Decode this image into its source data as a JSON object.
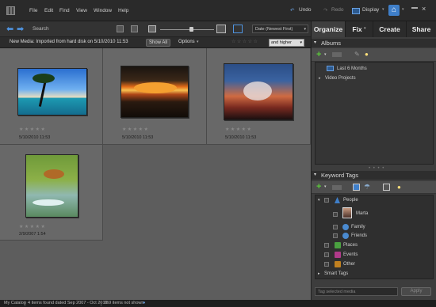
{
  "menu": [
    "File",
    "Edit",
    "Find",
    "View",
    "Window",
    "Help"
  ],
  "toolbar_right": {
    "undo": "Undo",
    "redo": "Redo",
    "display": "Display"
  },
  "tabs": [
    "Organize",
    "Fix",
    "Create",
    "Share"
  ],
  "search": {
    "label": "Search"
  },
  "sort": {
    "selected": "Date (Newest First)"
  },
  "mediabar": {
    "text": "New Media: Imported from hard disk on 5/10/2010 11:53",
    "show_all": "Show All",
    "options": "Options",
    "rating_filter": "and higher"
  },
  "photos": [
    {
      "date": "5/10/2010 11:53",
      "stars": "★★★★★",
      "subject": "tropical beach with palm tree"
    },
    {
      "date": "5/10/2010 11:53",
      "stars": "★★★★★",
      "subject": "sunset cloud over water"
    },
    {
      "date": "5/10/2010 11:53",
      "stars": "★★★★★",
      "subject": "storm cloud at sunset"
    },
    {
      "date": "2/9/2007 1:54",
      "stars": "★★★★★",
      "subject": "dog leaping over water"
    }
  ],
  "albums": {
    "title": "Albums",
    "items": [
      "Last 6 Months",
      "Video Projects"
    ]
  },
  "keywords": {
    "title": "Keyword Tags",
    "people": "People",
    "marta": "Marta",
    "family": "Family",
    "friends": "Friends",
    "places": "Places",
    "events": "Events",
    "other": "Other",
    "smart": "Smart Tags",
    "tag_placeholder": "Tag selected media",
    "apply": "Apply"
  },
  "status": {
    "catalog": "My Catalog",
    "found": "4 items found dated Sep 2007 - Oct 2010",
    "not_shown": "769 items not shown"
  },
  "colors": {
    "accent": "#3f7fc9"
  }
}
